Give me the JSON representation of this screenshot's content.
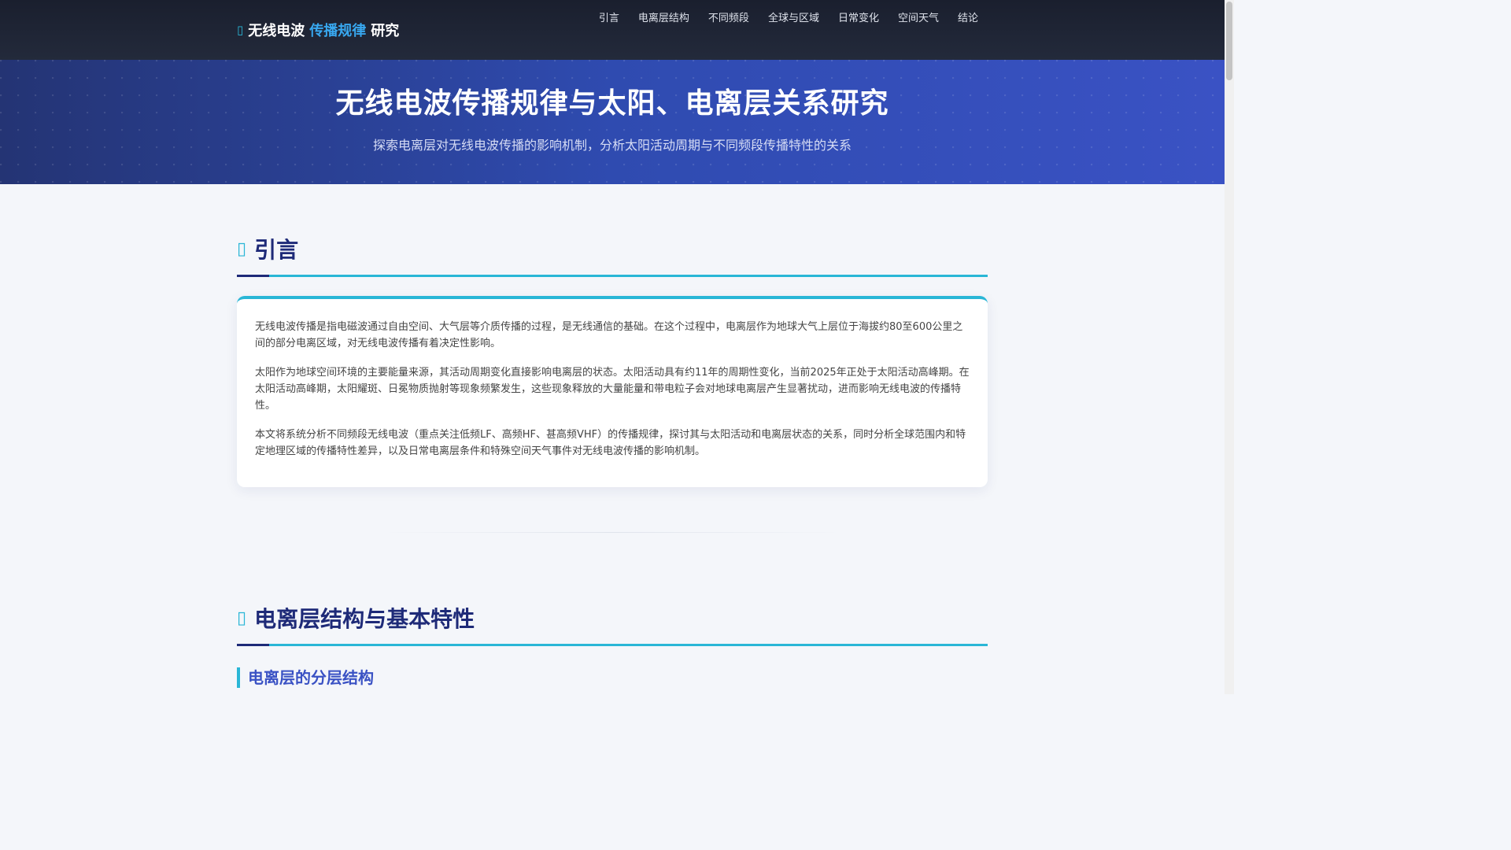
{
  "navbar": {
    "brand_icon": "antenna-icon",
    "brand_part1": "无线电波",
    "brand_part2": "传播规律",
    "brand_part3": "研究",
    "links": [
      "引言",
      "电离层结构",
      "不同频段",
      "全球与区域",
      "日常变化",
      "空间天气",
      "结论"
    ]
  },
  "hero": {
    "title": "无线电波传播规律与太阳、电离层关系研究",
    "subtitle": "探索电离层对无线电波传播的影响机制，分析太阳活动周期与不同频段传播特性的关系"
  },
  "intro": {
    "heading_icon": "broadcast-icon",
    "heading": "引言",
    "paragraphs": [
      "无线电波传播是指电磁波通过自由空间、大气层等介质传播的过程，是无线通信的基础。在这个过程中，电离层作为地球大气上层位于海拔约80至600公里之间的部分电离区域，对无线电波传播有着决定性影响。",
      "太阳作为地球空间环境的主要能量来源，其活动周期变化直接影响电离层的状态。太阳活动具有约11年的周期性变化，当前2025年正处于太阳活动高峰期。在太阳活动高峰期，太阳耀斑、日冕物质抛射等现象频繁发生，这些现象释放的大量能量和带电粒子会对地球电离层产生显著扰动，进而影响无线电波的传播特性。",
      "本文将系统分析不同频段无线电波（重点关注低频LF、高频HF、甚高频VHF）的传播规律，探讨其与太阳活动和电离层状态的关系，同时分析全球范围内和特定地理区域的传播特性差异，以及日常电离层条件和特殊空间天气事件对无线电波传播的影响机制。"
    ]
  },
  "ionosphere": {
    "heading_icon": "layers-icon",
    "heading": "电离层结构与基本特性",
    "subheading": "电离层的分层结构"
  },
  "colors": {
    "accent": "#29b6d6",
    "heading": "#1e2a78",
    "navbar": "#1a1f2e",
    "hero": "#2f4bb0"
  }
}
